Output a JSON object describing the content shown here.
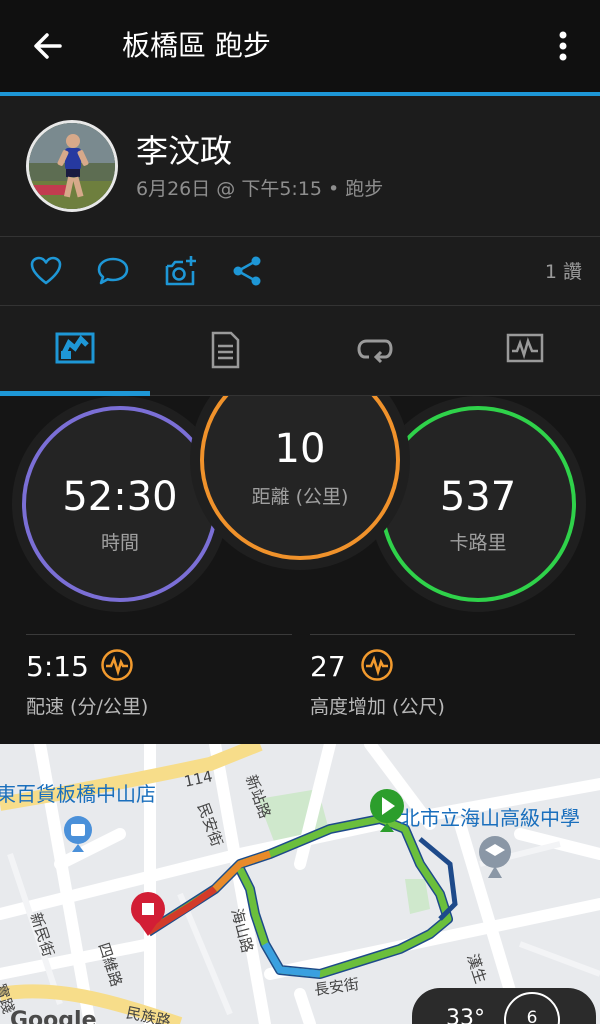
{
  "appbar": {
    "title": "板橋區 跑步"
  },
  "activity": {
    "user_name": "李汶政",
    "subtitle": "6月26日 @ 下午5:15 • 跑步"
  },
  "actions": {
    "likes": "1 讚"
  },
  "tabs": [
    {
      "icon": "map-stats-icon",
      "selected": true
    },
    {
      "icon": "document-icon",
      "selected": false
    },
    {
      "icon": "laps-icon",
      "selected": false
    },
    {
      "icon": "chart-icon",
      "selected": false
    }
  ],
  "stats": {
    "time": {
      "value": "52:30",
      "label": "時間"
    },
    "distance": {
      "value": "10",
      "label": "距離 (公里)"
    },
    "calories": {
      "value": "537",
      "label": "卡路里"
    },
    "pace": {
      "value": "5:15",
      "label": "配速 (分/公里)"
    },
    "elevation": {
      "value": "27",
      "label": "高度增加 (公尺)"
    }
  },
  "map": {
    "poi_1": "東百貨板橋中山店",
    "poi_2": "北市立海山高級中學",
    "roads": {
      "r114": "114",
      "xinzhan": "新站路",
      "minan": "民安街",
      "haishan": "海山路",
      "changan": "長安街",
      "xinmin": "新民街",
      "silian": "四維路",
      "hansheng": "漢生",
      "shijian": "實踐",
      "minzu": "民族路"
    },
    "weather": {
      "temp": "33°",
      "wind": "6"
    },
    "attribution": "Google"
  },
  "colors": {
    "accent": "#1e97d6",
    "time_ring": "#7b6fd6",
    "distance_ring": "#f0922b",
    "calories_ring": "#2fd24a",
    "metric_icon": "#f29a2e"
  }
}
